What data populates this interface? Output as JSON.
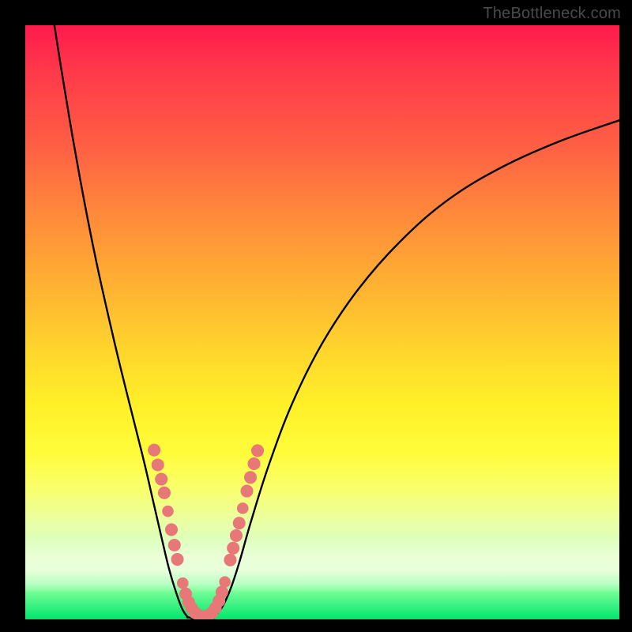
{
  "attribution": "TheBottleneck.com",
  "colors": {
    "frame": "#000000",
    "curve": "#000000",
    "marker": "#e87878",
    "gradient_top": "#ff1a4c",
    "gradient_bottom": "#00e66c"
  },
  "chart_data": {
    "type": "line",
    "title": "",
    "xlabel": "",
    "ylabel": "",
    "xlim": [
      0,
      100
    ],
    "ylim": [
      0,
      100
    ],
    "grid": false,
    "note": "No numeric axis ticks are rendered; values are normalized 0–100 estimates read from pixel positions.",
    "series": [
      {
        "name": "left-branch",
        "x": [
          4.9,
          6.0,
          8.0,
          10.0,
          12.0,
          14.0,
          16.0,
          18.0,
          20.0,
          21.5,
          23.0,
          24.2,
          25.4,
          26.4,
          27.3
        ],
        "y": [
          100.0,
          93.0,
          81.0,
          70.0,
          60.0,
          51.0,
          42.5,
          34.5,
          26.5,
          20.0,
          13.5,
          8.5,
          4.5,
          1.8,
          0.4
        ]
      },
      {
        "name": "valley-floor",
        "x": [
          27.3,
          28.4,
          29.6,
          30.8,
          31.8
        ],
        "y": [
          0.4,
          0.1,
          0.0,
          0.1,
          0.35
        ]
      },
      {
        "name": "right-branch",
        "x": [
          31.8,
          33.1,
          34.5,
          36.0,
          38.0,
          41.0,
          45.0,
          50.0,
          56.0,
          63.0,
          71.0,
          80.0,
          90.0,
          100.0
        ],
        "y": [
          0.35,
          2.0,
          5.0,
          9.5,
          16.5,
          26.0,
          36.5,
          46.5,
          55.5,
          63.5,
          70.5,
          76.0,
          80.5,
          84.0
        ]
      }
    ],
    "markers": {
      "name": "highlighted-points",
      "color": "#e87878",
      "points": [
        {
          "x": 21.7,
          "y": 28.5,
          "r": 1.1
        },
        {
          "x": 22.3,
          "y": 26.0,
          "r": 1.1
        },
        {
          "x": 22.9,
          "y": 23.6,
          "r": 1.1
        },
        {
          "x": 23.4,
          "y": 21.3,
          "r": 1.1
        },
        {
          "x": 24.0,
          "y": 18.2,
          "r": 1.0
        },
        {
          "x": 24.6,
          "y": 15.1,
          "r": 1.1
        },
        {
          "x": 25.1,
          "y": 12.5,
          "r": 1.1
        },
        {
          "x": 25.6,
          "y": 10.1,
          "r": 1.1
        },
        {
          "x": 26.5,
          "y": 6.1,
          "r": 1.0
        },
        {
          "x": 27.0,
          "y": 4.3,
          "r": 1.1
        },
        {
          "x": 27.5,
          "y": 2.9,
          "r": 1.1
        },
        {
          "x": 28.0,
          "y": 1.9,
          "r": 1.1
        },
        {
          "x": 28.6,
          "y": 1.1,
          "r": 1.1
        },
        {
          "x": 29.3,
          "y": 0.6,
          "r": 1.1
        },
        {
          "x": 30.0,
          "y": 0.45,
          "r": 1.1
        },
        {
          "x": 30.7,
          "y": 0.6,
          "r": 1.1
        },
        {
          "x": 31.4,
          "y": 1.1,
          "r": 1.1
        },
        {
          "x": 32.0,
          "y": 1.9,
          "r": 1.1
        },
        {
          "x": 32.6,
          "y": 3.1,
          "r": 1.1
        },
        {
          "x": 33.1,
          "y": 4.6,
          "r": 1.1
        },
        {
          "x": 33.6,
          "y": 6.3,
          "r": 1.0
        },
        {
          "x": 34.5,
          "y": 10.0,
          "r": 1.1
        },
        {
          "x": 35.0,
          "y": 12.0,
          "r": 1.1
        },
        {
          "x": 35.5,
          "y": 14.1,
          "r": 1.1
        },
        {
          "x": 36.0,
          "y": 16.2,
          "r": 1.1
        },
        {
          "x": 36.6,
          "y": 18.7,
          "r": 1.0
        },
        {
          "x": 37.3,
          "y": 21.6,
          "r": 1.1
        },
        {
          "x": 37.9,
          "y": 23.9,
          "r": 1.1
        },
        {
          "x": 38.5,
          "y": 26.2,
          "r": 1.1
        },
        {
          "x": 39.1,
          "y": 28.4,
          "r": 1.1
        }
      ]
    }
  }
}
